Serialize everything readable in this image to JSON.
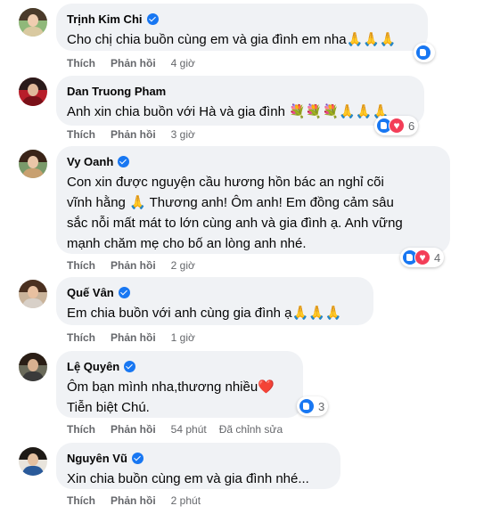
{
  "comments": [
    {
      "author": "Trịnh Kim Chi",
      "text": "Cho chị chia buồn cùng em và gia đình em nha🙏🙏🙏",
      "like": "Thích",
      "reply": "Phản hồi",
      "time": "4 giờ",
      "edited": "",
      "reactions": {
        "types": [
          "like"
        ],
        "count": ""
      },
      "avatar_colors": {
        "bg": "#8fb87a",
        "hair": "#4a3a2a",
        "face": "#f0cdb0",
        "body": "#d9c9a0"
      }
    },
    {
      "author": "Dan Truong Pham",
      "text": "Anh xin chia buồn với Hà và gia đình 💐💐💐🙏🙏🙏",
      "like": "Thích",
      "reply": "Phản hồi",
      "time": "3 giờ",
      "edited": "",
      "reactions": {
        "types": [
          "like",
          "love"
        ],
        "count": "6"
      },
      "avatar_colors": {
        "bg": "#b81e2a",
        "hair": "#2a1a1a",
        "face": "#e0b89a",
        "body": "#7a1018"
      }
    },
    {
      "author": "Vy Oanh",
      "text": "Con xin được nguyện cầu hương hồn bác an nghỉ cõi\nvĩnh hằng 🙏 Thương anh! Ôm anh! Em đồng cảm sâu\nsắc nỗi mất mát to lớn cùng anh và gia đình ạ. Anh vững\nmạnh chăm mẹ cho bố an lòng anh nhé.",
      "like": "Thích",
      "reply": "Phản hồi",
      "time": "2 giờ",
      "edited": "",
      "reactions": {
        "types": [
          "like",
          "love"
        ],
        "count": "4"
      },
      "avatar_colors": {
        "bg": "#7a9a6a",
        "hair": "#3a2418",
        "face": "#eac6a8",
        "body": "#c8a070"
      }
    },
    {
      "author": "Quế Vân",
      "text": "Em chia buồn với anh cùng gia đình ạ🙏🙏🙏",
      "like": "Thích",
      "reply": "Phản hồi",
      "time": "1 giờ",
      "edited": "",
      "reactions": {
        "types": [],
        "count": ""
      },
      "avatar_colors": {
        "bg": "#c9b39a",
        "hair": "#4a3020",
        "face": "#e8c0a0",
        "body": "#d8d0c8"
      }
    },
    {
      "author": "Lệ Quyên",
      "text": "Ôm bạn mình nha,thương nhiều❤️\nTiễn biệt Chú.",
      "like": "Thích",
      "reply": "Phản hồi",
      "time": "54 phút",
      "edited": "Đã chỉnh sửa",
      "reactions": {
        "types": [
          "like"
        ],
        "count": "3"
      },
      "avatar_colors": {
        "bg": "#6a6a5a",
        "hair": "#2a1e16",
        "face": "#d8b090",
        "body": "#3a3a3a"
      }
    },
    {
      "author": "Nguyên Vũ",
      "text": "Xin chia buồn cùng em và gia đình nhé...",
      "like": "Thích",
      "reply": "Phản hồi",
      "time": "2 phút",
      "edited": "",
      "reactions": {
        "types": [],
        "count": ""
      },
      "avatar_colors": {
        "bg": "#e8e4dc",
        "hair": "#1e1a16",
        "face": "#e4c0a0",
        "body": "#2a5a9a"
      }
    }
  ],
  "colors": {
    "bubble": "#f0f2f5",
    "secondary_text": "#65676b",
    "verified": "#1877f2",
    "like": "#1877f2",
    "love": "#f33e58"
  }
}
